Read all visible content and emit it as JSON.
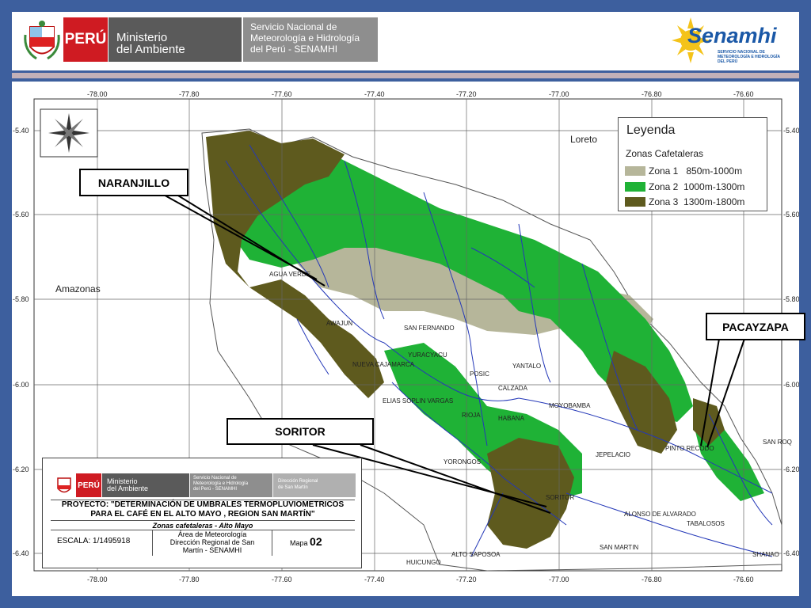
{
  "header": {
    "peru": "PERÚ",
    "ministerio": "Ministerio del Ambiente",
    "ministerio_line1": "Ministerio",
    "ministerio_line2": "del Ambiente",
    "senamhi_line1": "Servicio Nacional de",
    "senamhi_line2": "Meteorología e Hidrología",
    "senamhi_line3": "del Perú - SENAMHI",
    "logo_word": "Senamhi",
    "logo_sub": "SERVICIO NACIONAL DE METEOROLOGÍA E HIDROLOGÍA DEL PERÚ"
  },
  "map": {
    "lon_ticks": [
      "-78.00",
      "-77.80",
      "-77.60",
      "-77.40",
      "-77.20",
      "-77.00",
      "-76.80",
      "-76.60"
    ],
    "lat_ticks": [
      "-5.40",
      "-5.60",
      "-5.80",
      "-6.00",
      "-6.20",
      "-6.40"
    ],
    "regions": {
      "loreto": "Loreto",
      "amazonas": "Amazonas"
    },
    "towns": {
      "aguaverde": "AGUA VERDE",
      "awajun": "AWAJUN",
      "nueva_cajamarca": "NUEVA CAJAMARCA",
      "elias_soplin": "ELIAS SOPLIN VARGAS",
      "san_fernando": "SAN FERNANDO",
      "yuracyacu": "YURACYACU",
      "posic": "POSIC",
      "yantalo": "YANTALO",
      "calzada": "CALZADA",
      "rioja": "RIOJA",
      "habana": "HABANA",
      "moyobamba": "MOYOBAMBA",
      "yorongos": "YORONGOS",
      "jepelacio": "JEPELACIO",
      "pinto_recodo": "PINTO RECODO",
      "san_roque": "SAN ROQ",
      "soritor_town": "SORITOR",
      "alonso": "ALONSO DE ALVARADO",
      "tabalosos": "TABALOSOS",
      "san_martin": "SAN MARTIN",
      "shanao": "SHANAO",
      "huicungo": "HUICUNGO",
      "altomayo": "ALTO SAPOSOA"
    }
  },
  "callouts": {
    "naranjillo": "NARANJILLO",
    "soritor": "SORITOR",
    "pacayzapa": "PACAYZAPA"
  },
  "legend": {
    "title": "Leyenda",
    "subtitle": "Zonas Cafetaleras",
    "items": [
      {
        "label": "Zona 1   850m-1000m",
        "color": "#b6b69a"
      },
      {
        "label": "Zona 2  1000m-1300m",
        "color": "#1fb236"
      },
      {
        "label": "Zona 3  1300m-1800m",
        "color": "#5e5a1e"
      }
    ]
  },
  "titleblock": {
    "peru": "PERÚ",
    "ministerio_line1": "Ministerio",
    "ministerio_line2": "del Ambiente",
    "senamhi_line1": "Servicio Nacional de",
    "senamhi_line2": "Meteorología e Hidrología",
    "senamhi_line3": "del Perú - SENAMHI",
    "direccion_line1": "Dirección Regional",
    "direccion_line2": "de San Martín",
    "proyecto_line1": "PROYECTO: \"DETERMINACIÓN DE UMBRALES TERMOPLUVIOMETRICOS",
    "proyecto_line2": "PARA EL CAFÉ EN EL ALTO MAYO , REGION SAN MARTÍN\"",
    "zonas": "Zonas cafetaleras - Alto Mayo",
    "escala": "ESCALA: 1/1495918",
    "area_line1": "Área de Meteorología",
    "area_line2": "Dirección Regional de San",
    "area_line3": "Martín - SENAMHI",
    "mapa_label": "Mapa",
    "mapa_num": "02"
  },
  "colors": {
    "frame": "#3d5f9e",
    "zona1": "#b6b69a",
    "zona2": "#1fb236",
    "zona3": "#5e5a1e",
    "river": "#2438b8"
  }
}
